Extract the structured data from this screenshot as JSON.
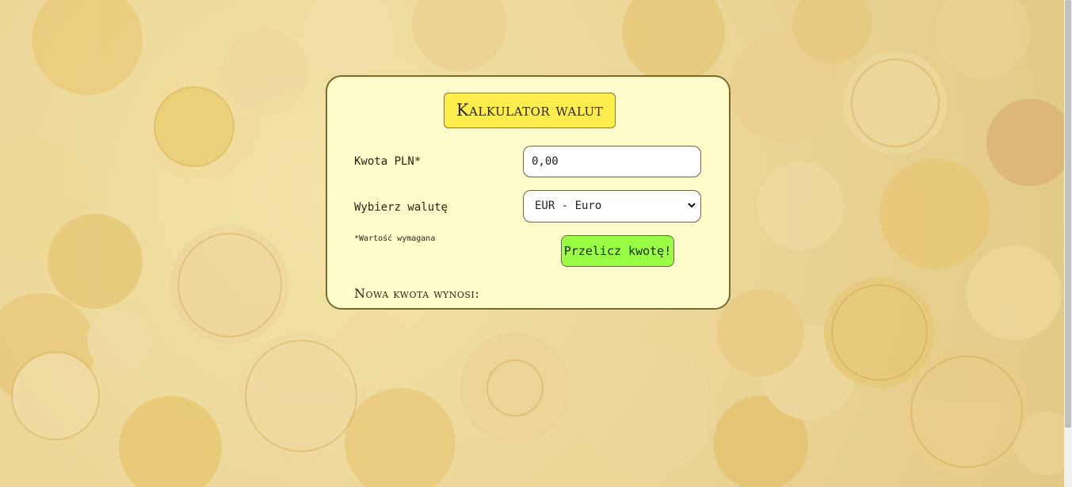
{
  "calculator": {
    "title": "Kalkulator walut",
    "amount_label": "Kwota PLN*",
    "amount_value": "0,00",
    "currency_label": "Wybierz walutę",
    "currency_selected": "EUR - Euro",
    "required_note": "*Wartość wymagana",
    "convert_button": "Przelicz kwotę!",
    "result_label": "Nowa kwota wynosi:"
  },
  "colors": {
    "card_background": "#fffdcc",
    "title_background": "#ffec4d",
    "button_background": "#99ff44",
    "border": "#7a6a2a"
  },
  "icons": {
    "select_arrow": "chevron-down-icon"
  }
}
